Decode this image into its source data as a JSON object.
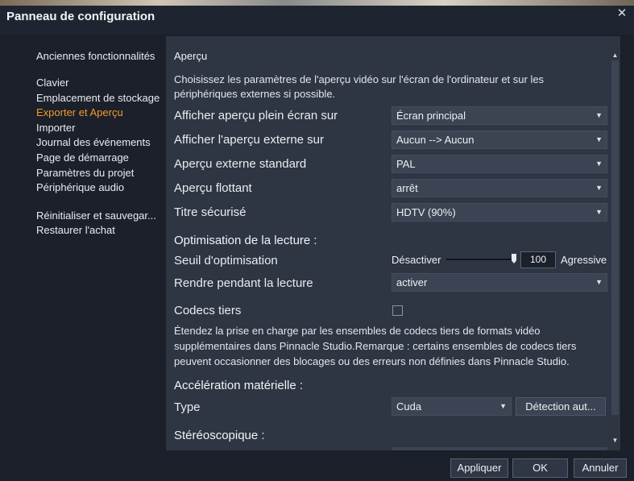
{
  "window": {
    "title": "Panneau de configuration",
    "close_symbol": "✕"
  },
  "sidebar": {
    "items": [
      {
        "label": "Anciennes fonctionnalités",
        "active": false
      },
      {
        "label": "Clavier",
        "active": false
      },
      {
        "label": "Emplacement de stockage",
        "active": false
      },
      {
        "label": "Exporter et Aperçu",
        "active": true
      },
      {
        "label": "Importer",
        "active": false
      },
      {
        "label": "Journal des événements",
        "active": false
      },
      {
        "label": "Page de démarrage",
        "active": false
      },
      {
        "label": "Paramètres du projet",
        "active": false
      },
      {
        "label": "Périphérique audio",
        "active": false
      },
      {
        "label": "Réinitialiser et sauvegar...",
        "active": false
      },
      {
        "label": "Restaurer l'achat",
        "active": false
      }
    ],
    "active_color": "#f39a2c"
  },
  "content": {
    "section_title": "Aperçu",
    "intro": "Choisissez les paramètres de l'aperçu vidéo sur l'écran de l'ordinateur et sur les périphériques externes si possible.",
    "preview_rows": [
      {
        "label": "Afficher aperçu plein écran sur",
        "value": "Écran principal"
      },
      {
        "label": "Afficher l'aperçu externe sur",
        "value": "Aucun --> Aucun"
      },
      {
        "label": "Aperçu externe standard",
        "value": "PAL"
      },
      {
        "label": "Aperçu flottant",
        "value": "arrêt"
      },
      {
        "label": "Titre sécurisé",
        "value": "HDTV (90%)"
      }
    ],
    "playback_heading": "Optimisation de la lecture :",
    "optimization": {
      "label": "Seuil d'optimisation",
      "min_label": "Désactiver",
      "max_label": "Agressive",
      "value": "100"
    },
    "render_row": {
      "label": "Rendre pendant la lecture",
      "value": "activer"
    },
    "codecs": {
      "label": "Codecs tiers",
      "checked": false,
      "description": "Étendez la prise en charge par les ensembles de codecs tiers de formats vidéo supplémentaires dans Pinnacle Studio.Remarque : certains ensembles de codecs tiers peuvent occasionner des blocages ou des erreurs non définies dans Pinnacle Studio."
    },
    "hw_heading": "Accélération matérielle :",
    "hw_type": {
      "label": "Type",
      "value": "Cuda",
      "detect_label": "Détection aut..."
    },
    "stereo_heading": "Stéréoscopique :"
  },
  "footer": {
    "apply_label": "Appliquer",
    "ok_label": "OK",
    "cancel_label": "Annuler"
  },
  "icons": {
    "caret_down": "▼",
    "scroll_up": "▲",
    "scroll_down": "▼"
  }
}
